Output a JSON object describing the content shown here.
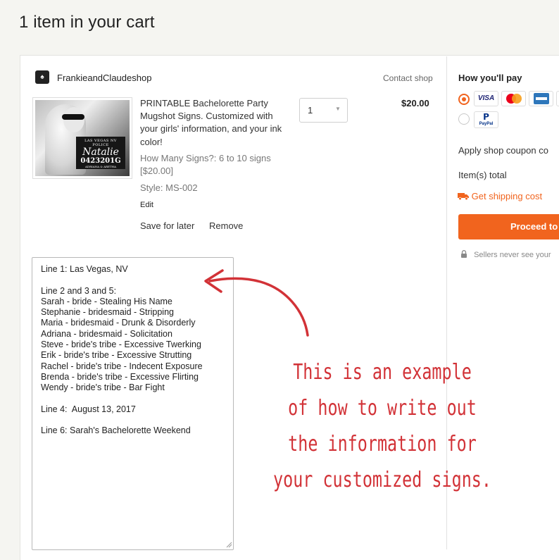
{
  "header": {
    "title": "1 item in your cart"
  },
  "shop": {
    "name": "FrankieandClaudeshop",
    "logo_glyph": "♠",
    "contact_label": "Contact shop"
  },
  "item": {
    "thumb_image": {
      "line1": "LAS VEGAS NV POLICE",
      "script": "Natalie",
      "number": "0423201G",
      "sub": "ADRIANA & ARETHA"
    },
    "title": "PRINTABLE Bachelorette Party Mugshot Signs. Customized with your girls' information, and your ink color!",
    "variation": "How Many Signs?: 6 to 10 signs [$20.00]",
    "style": "Style: MS-002",
    "edit_label": "Edit",
    "save_later_label": "Save for later",
    "remove_label": "Remove",
    "quantity": "1",
    "price": "$20.00"
  },
  "note": {
    "text": "Line 1: Las Vegas, NV\n\nLine 2 and 3 and 5:\nSarah - bride - Stealing His Name\nStephanie - bridesmaid - Stripping\nMaria - bridesmaid - Drunk & Disorderly\nAdriana - bridesmaid - Solicitation\nSteve - bride's tribe - Excessive Twerking\nErik - bride's tribe - Excessive Strutting\nRachel - bride's tribe - Indecent Exposure\nBrenda - bride's tribe - Excessive Flirting\nWendy - bride's tribe - Bar Fight\n\nLine 4:  August 13, 2017\n\nLine 6: Sarah's Bachelorette Weekend"
  },
  "payment": {
    "title": "How you'll pay",
    "methods": [
      {
        "label": "VISA",
        "color": "#1a1f71"
      },
      {
        "label": "mastercard",
        "color": "#eb001b"
      },
      {
        "label": "AMEX",
        "color": "#2e77bb"
      },
      {
        "label": "PayPal",
        "color": "#003087"
      }
    ],
    "coupon_label": "Apply shop coupon co",
    "items_total_label": "Item(s) total",
    "shipping_label": "Get shipping cost",
    "proceed_label": "Proceed to",
    "sellers_note": "Sellers never see your"
  },
  "annotation": {
    "lines": [
      "This is an example",
      "of how to write out",
      "the information for",
      "your customized signs."
    ],
    "color": "#d23237"
  },
  "colors": {
    "accent": "#f1641e",
    "background": "#f5f5f1"
  }
}
